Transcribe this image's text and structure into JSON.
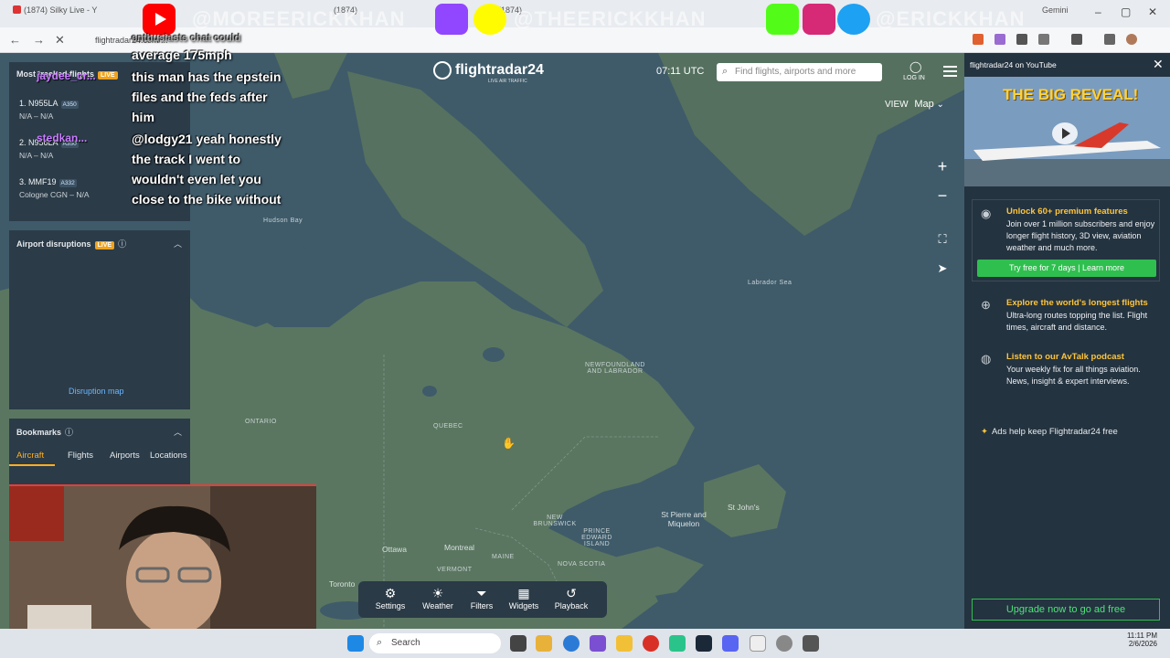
{
  "browser": {
    "tabs": [
      {
        "label": "(1874) Silky Live - Y"
      },
      {
        "label": "(1874)"
      },
      {
        "label": "(1874)"
      },
      {
        "label": "Gemini"
      }
    ],
    "url": "flightradar24.com/..."
  },
  "overlay": {
    "banner_left": "@MOREERICKKHAN",
    "banner_mid": "@THEERICKKHAN",
    "banner_right": "@ERICKKHAN"
  },
  "map": {
    "logo_name": "flightradar24",
    "logo_sub": "LIVE AIR TRAFFIC",
    "clock": "07:11 UTC",
    "search_placeholder": "Find flights, airports and more",
    "login_label": "LOG IN",
    "view_label": "VIEW",
    "view_value": "Map",
    "labels": {
      "ontario": "ONTARIO",
      "quebec": "QUEBEC",
      "newfoundland": "NEWFOUNDLAND AND LABRADOR",
      "new_brunswick": "NEW BRUNSWICK",
      "pei": "PRINCE EDWARD ISLAND",
      "nova_scotia": "NOVA SCOTIA",
      "maine": "MAINE",
      "vermont": "VERMONT",
      "st_pierre": "St Pierre and Miquelon",
      "ottawa": "Ottawa",
      "montreal": "Montreal",
      "toronto": "Toronto",
      "st_johns": "St John's",
      "labrador_sea": "Labrador Sea",
      "hudson_bay": "Hudson Bay"
    }
  },
  "toolbar": {
    "items": [
      {
        "label": "Settings",
        "icon": "gear-icon"
      },
      {
        "label": "Weather",
        "icon": "weather-icon"
      },
      {
        "label": "Filters",
        "icon": "filter-icon"
      },
      {
        "label": "Widgets",
        "icon": "widgets-icon"
      },
      {
        "label": "Playback",
        "icon": "playback-icon"
      }
    ]
  },
  "left_panel": {
    "tracked_title": "Most tracked flights",
    "live_badge": "LIVE",
    "flights": [
      {
        "main": "1. N955LA",
        "tag": "A350",
        "sub": "N/A – N/A"
      },
      {
        "main": "2. N956LA",
        "tag": "A350",
        "sub": "N/A – N/A"
      },
      {
        "main": "3. MMF19",
        "tag": "A332",
        "sub": "Cologne CGN – N/A"
      }
    ],
    "disruptions_title": "Airport disruptions",
    "disruption_link": "Disruption map",
    "bookmarks_title": "Bookmarks",
    "bookmark_tabs": [
      "Aircraft",
      "Flights",
      "Airports",
      "Locations"
    ]
  },
  "chat": {
    "lines": [
      "average 175mph",
      "this man has the epstein",
      "files and the feds after",
      "him",
      "@lodgy21 yeah honestly",
      "the track I went to",
      "wouldn't even let you",
      "close to the bike without"
    ],
    "top_fragment": "enthusiasts chat could",
    "names": [
      "jaydee_cr...",
      "stedkan..."
    ]
  },
  "right_panel": {
    "header": "flightradar24 on YouTube",
    "video_title": "THE BIG REVEAL!",
    "promos": [
      {
        "title": "Unlock 60+ premium features",
        "desc": "Join over 1 million subscribers and enjoy longer flight history, 3D view, aviation weather and much more."
      },
      {
        "title": "Explore the world's longest flights",
        "desc": "Ultra-long routes topping the list. Flight times, aircraft and distance."
      },
      {
        "title": "Listen to our AvTalk podcast",
        "desc": "Your weekly fix for all things aviation. News, insight & expert interviews."
      }
    ],
    "trial_button": "Try free for 7 days | Learn more",
    "ads_note": "Ads help keep Flightradar24 free",
    "upgrade_button": "Upgrade now to go ad free"
  },
  "taskbar": {
    "search_label": "Search",
    "time": "11:11 PM",
    "date": "2/6/2026"
  },
  "colors": {
    "map_bg": "#3f5b6a",
    "accent": "#ffb020",
    "green": "#2fbf4f",
    "live": "#f0a31d"
  }
}
